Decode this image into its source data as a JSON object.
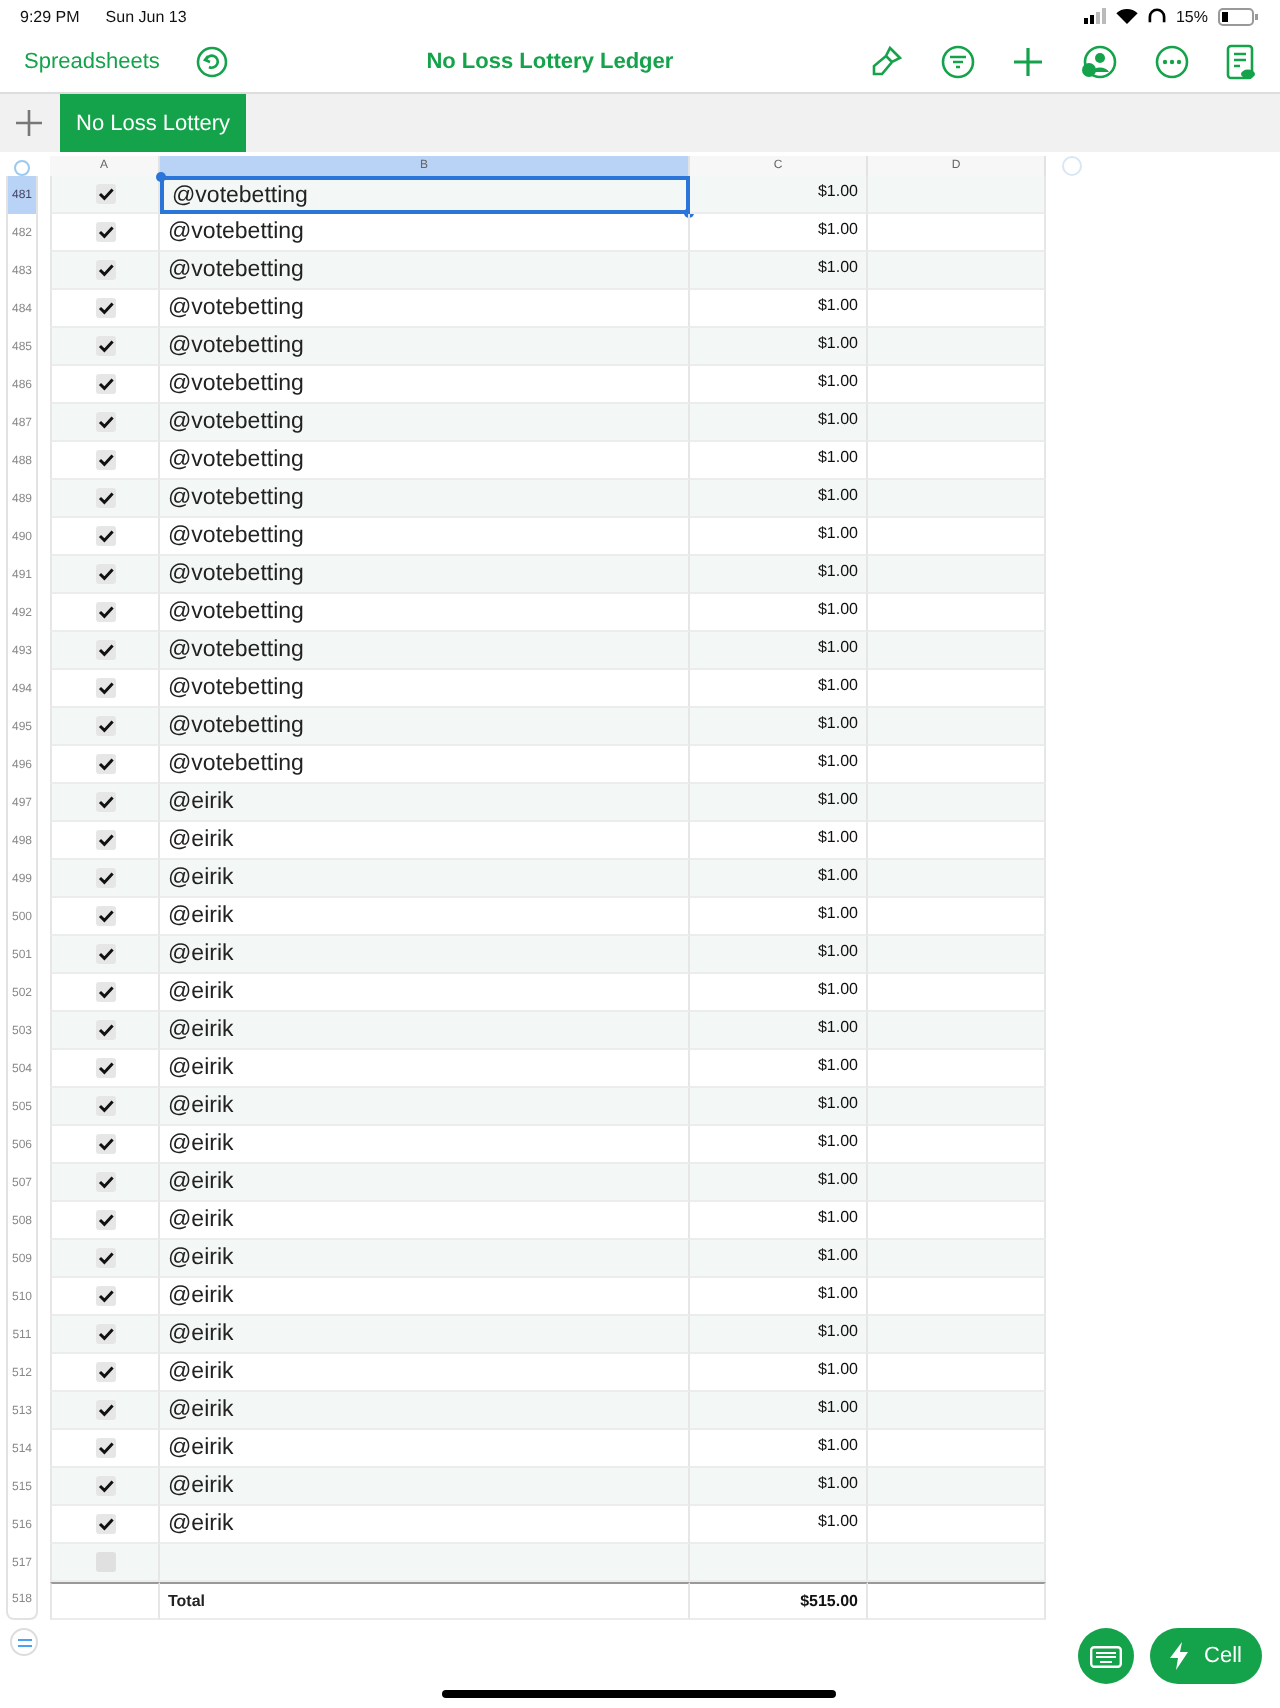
{
  "status_bar": {
    "time": "9:29 PM",
    "date": "Sun Jun 13",
    "battery": "15%"
  },
  "toolbar": {
    "back": "Spreadsheets",
    "title": "No Loss Lottery Ledger"
  },
  "sheet_tabs": [
    {
      "label": "No Loss Lottery",
      "selected": true
    }
  ],
  "table": {
    "columns": [
      {
        "label": "A",
        "selected": false
      },
      {
        "label": "B",
        "selected": true
      },
      {
        "label": "C",
        "selected": false
      },
      {
        "label": "D",
        "selected": false
      }
    ],
    "rows": [
      {
        "row": "481",
        "checked": true,
        "name": "@votebetting",
        "amount": "$1.00",
        "selected": true
      },
      {
        "row": "482",
        "checked": true,
        "name": "@votebetting",
        "amount": "$1.00",
        "selected": false
      },
      {
        "row": "483",
        "checked": true,
        "name": "@votebetting",
        "amount": "$1.00",
        "selected": false
      },
      {
        "row": "484",
        "checked": true,
        "name": "@votebetting",
        "amount": "$1.00",
        "selected": false
      },
      {
        "row": "485",
        "checked": true,
        "name": "@votebetting",
        "amount": "$1.00",
        "selected": false
      },
      {
        "row": "486",
        "checked": true,
        "name": "@votebetting",
        "amount": "$1.00",
        "selected": false
      },
      {
        "row": "487",
        "checked": true,
        "name": "@votebetting",
        "amount": "$1.00",
        "selected": false
      },
      {
        "row": "488",
        "checked": true,
        "name": "@votebetting",
        "amount": "$1.00",
        "selected": false
      },
      {
        "row": "489",
        "checked": true,
        "name": "@votebetting",
        "amount": "$1.00",
        "selected": false
      },
      {
        "row": "490",
        "checked": true,
        "name": "@votebetting",
        "amount": "$1.00",
        "selected": false
      },
      {
        "row": "491",
        "checked": true,
        "name": "@votebetting",
        "amount": "$1.00",
        "selected": false
      },
      {
        "row": "492",
        "checked": true,
        "name": "@votebetting",
        "amount": "$1.00",
        "selected": false
      },
      {
        "row": "493",
        "checked": true,
        "name": "@votebetting",
        "amount": "$1.00",
        "selected": false
      },
      {
        "row": "494",
        "checked": true,
        "name": "@votebetting",
        "amount": "$1.00",
        "selected": false
      },
      {
        "row": "495",
        "checked": true,
        "name": "@votebetting",
        "amount": "$1.00",
        "selected": false
      },
      {
        "row": "496",
        "checked": true,
        "name": "@votebetting",
        "amount": "$1.00",
        "selected": false
      },
      {
        "row": "497",
        "checked": true,
        "name": "@eirik",
        "amount": "$1.00",
        "selected": false
      },
      {
        "row": "498",
        "checked": true,
        "name": "@eirik",
        "amount": "$1.00",
        "selected": false
      },
      {
        "row": "499",
        "checked": true,
        "name": "@eirik",
        "amount": "$1.00",
        "selected": false
      },
      {
        "row": "500",
        "checked": true,
        "name": "@eirik",
        "amount": "$1.00",
        "selected": false
      },
      {
        "row": "501",
        "checked": true,
        "name": "@eirik",
        "amount": "$1.00",
        "selected": false
      },
      {
        "row": "502",
        "checked": true,
        "name": "@eirik",
        "amount": "$1.00",
        "selected": false
      },
      {
        "row": "503",
        "checked": true,
        "name": "@eirik",
        "amount": "$1.00",
        "selected": false
      },
      {
        "row": "504",
        "checked": true,
        "name": "@eirik",
        "amount": "$1.00",
        "selected": false
      },
      {
        "row": "505",
        "checked": true,
        "name": "@eirik",
        "amount": "$1.00",
        "selected": false
      },
      {
        "row": "506",
        "checked": true,
        "name": "@eirik",
        "amount": "$1.00",
        "selected": false
      },
      {
        "row": "507",
        "checked": true,
        "name": "@eirik",
        "amount": "$1.00",
        "selected": false
      },
      {
        "row": "508",
        "checked": true,
        "name": "@eirik",
        "amount": "$1.00",
        "selected": false
      },
      {
        "row": "509",
        "checked": true,
        "name": "@eirik",
        "amount": "$1.00",
        "selected": false
      },
      {
        "row": "510",
        "checked": true,
        "name": "@eirik",
        "amount": "$1.00",
        "selected": false
      },
      {
        "row": "511",
        "checked": true,
        "name": "@eirik",
        "amount": "$1.00",
        "selected": false
      },
      {
        "row": "512",
        "checked": true,
        "name": "@eirik",
        "amount": "$1.00",
        "selected": false
      },
      {
        "row": "513",
        "checked": true,
        "name": "@eirik",
        "amount": "$1.00",
        "selected": false
      },
      {
        "row": "514",
        "checked": true,
        "name": "@eirik",
        "amount": "$1.00",
        "selected": false
      },
      {
        "row": "515",
        "checked": true,
        "name": "@eirik",
        "amount": "$1.00",
        "selected": false
      },
      {
        "row": "516",
        "checked": true,
        "name": "@eirik",
        "amount": "$1.00",
        "selected": false
      },
      {
        "row": "517",
        "checked": false,
        "selected": false
      }
    ],
    "total": {
      "row": "518",
      "label": "Total",
      "amount": "$515.00"
    }
  },
  "buttons": {
    "cell": "Cell"
  }
}
